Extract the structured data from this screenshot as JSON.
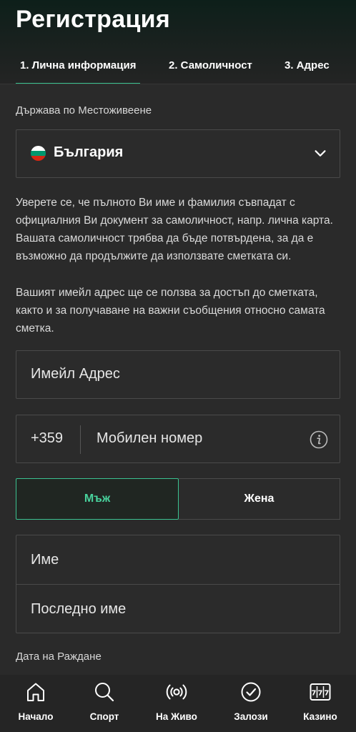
{
  "page": {
    "title": "Регистрация"
  },
  "steps": [
    {
      "label": "1. Лична информация",
      "active": true
    },
    {
      "label": "2. Самоличност",
      "active": false
    },
    {
      "label": "3. Адрес",
      "active": false
    }
  ],
  "country": {
    "label": "Държава по Местоживеене",
    "value": "България",
    "flag_icon": "bulgaria-flag-icon"
  },
  "info": {
    "paragraph_1": "Уверете се, че пълното Ви име и фамилия съвпадат с официалния Ви документ за самоличност, напр. лична карта. Вашата самоличност трябва да бъде потвърдена, за да е възможно да продължите да използвате сметката си.",
    "paragraph_2": "Вашият имейл адрес ще се ползва за достъп до сметката, както и за получаване на важни съобщения относно самата сметка."
  },
  "email": {
    "placeholder": "Имейл Адрес"
  },
  "phone": {
    "prefix": "+359",
    "placeholder": "Мобилен номер",
    "info_icon": "info-icon"
  },
  "gender": {
    "male": "Мъж",
    "female": "Жена",
    "selected": "male"
  },
  "name": {
    "first_placeholder": "Име",
    "last_placeholder": "Последно име"
  },
  "birthdate": {
    "label": "Дата на Раждане"
  },
  "nav": {
    "items": [
      {
        "label": "Начало",
        "icon": "home-icon"
      },
      {
        "label": "Спорт",
        "icon": "search-icon"
      },
      {
        "label": "На Живо",
        "icon": "live-broadcast-icon"
      },
      {
        "label": "Залози",
        "icon": "check-circle-icon"
      },
      {
        "label": "Казино",
        "icon": "slot-machine-icon"
      }
    ]
  },
  "colors": {
    "accent": "#3bc291",
    "background": "#2a2a2a",
    "field_border": "#4a4a4a"
  }
}
